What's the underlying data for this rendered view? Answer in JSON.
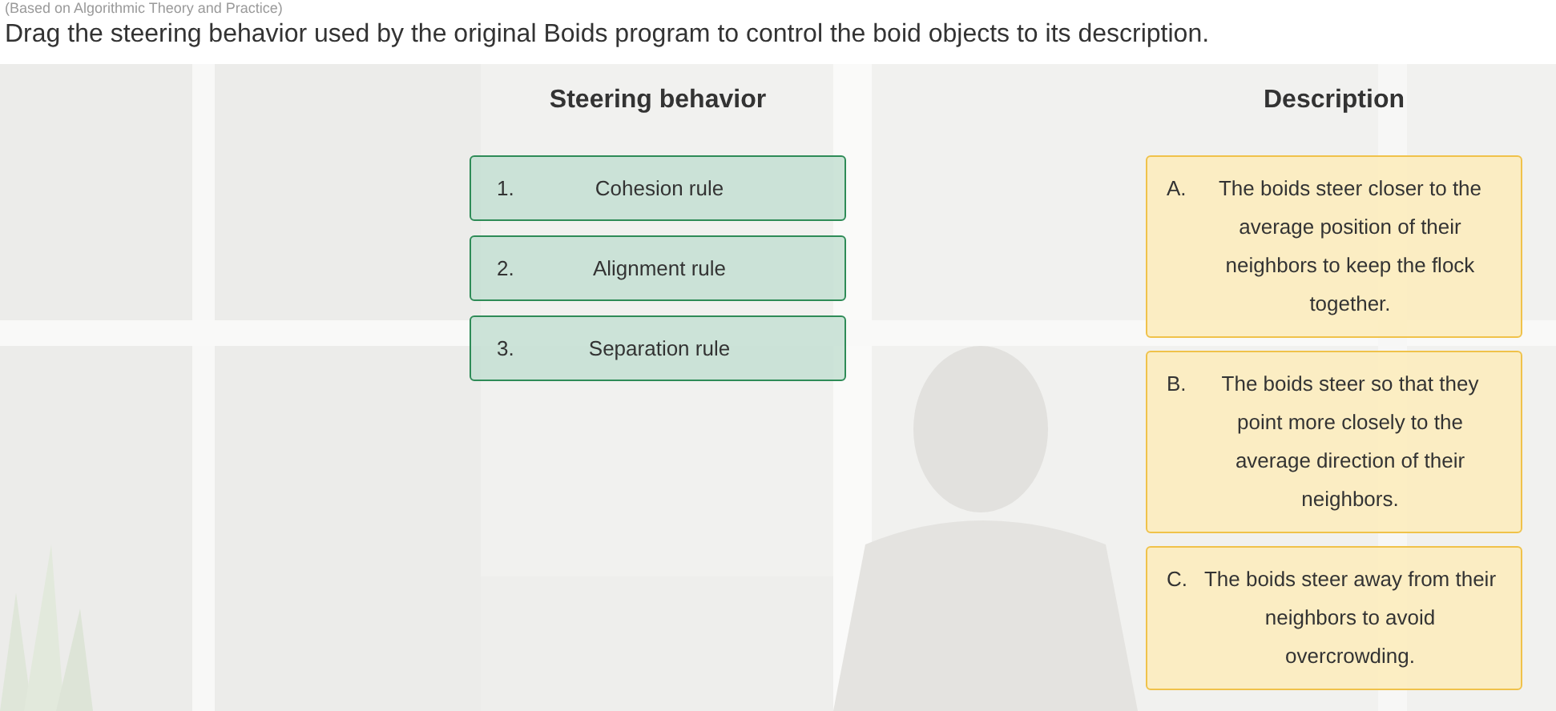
{
  "caption": "(Based on Algorithmic Theory and Practice)",
  "question": "Drag the steering behavior used by the original Boids program to control the boid objects to its description.",
  "behaviors": {
    "heading": "Steering behavior",
    "items": [
      {
        "number": "1.",
        "label": "Cohesion rule"
      },
      {
        "number": "2.",
        "label": "Alignment rule"
      },
      {
        "number": "3.",
        "label": "Separation rule"
      }
    ]
  },
  "descriptions": {
    "heading": "Description",
    "items": [
      {
        "letter": "A.",
        "text": "The boids steer closer to the average position of their neighbors to keep the flock together."
      },
      {
        "letter": "B.",
        "text": "The boids steer so that they point more closely to the average direction of their neighbors."
      },
      {
        "letter": "C.",
        "text": "The boids steer away from their neighbors to avoid overcrowding."
      }
    ]
  }
}
